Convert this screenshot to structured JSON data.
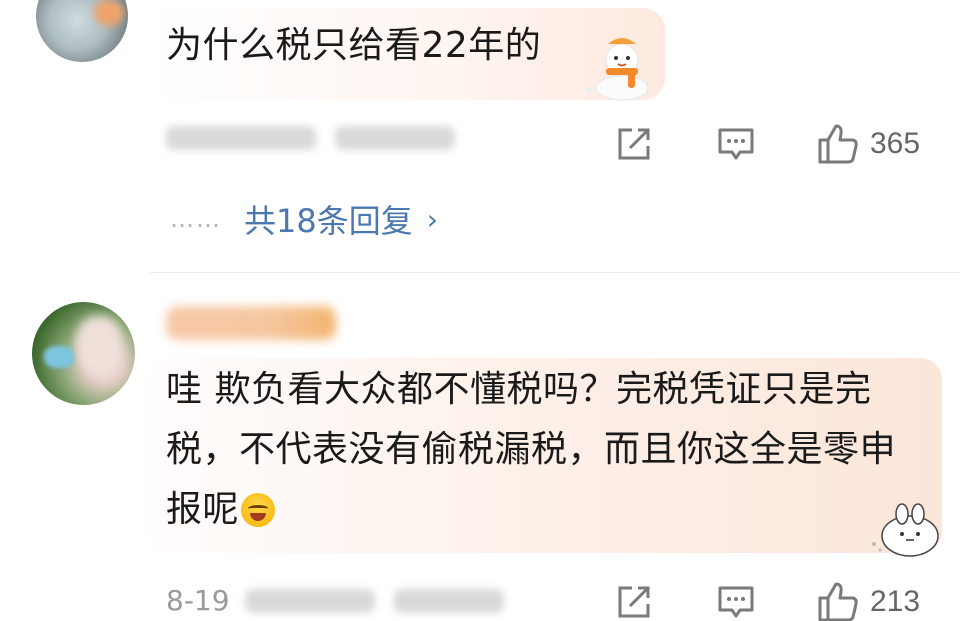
{
  "comments": [
    {
      "text": "为什么税只给看22年的",
      "actions": {
        "share_icon": "share-icon",
        "comment_icon": "comment-icon",
        "like_icon": "thumbs-up-icon",
        "likes": "365"
      },
      "replies": {
        "dots": "……",
        "label": "共18条回复",
        "chevron": "›"
      }
    },
    {
      "text": "哇 欺负看大众都不懂税吗？完税凭证只是完税，不代表没有偷税漏税，而且你这全是零申报呢",
      "meta_time": "8-19",
      "actions": {
        "share_icon": "share-icon",
        "comment_icon": "comment-icon",
        "like_icon": "thumbs-up-icon",
        "likes": "213"
      }
    }
  ],
  "colors": {
    "reply_link": "#4b78b0",
    "action_gray": "#7a7a7a",
    "bubble_peach": "#fde9df"
  }
}
